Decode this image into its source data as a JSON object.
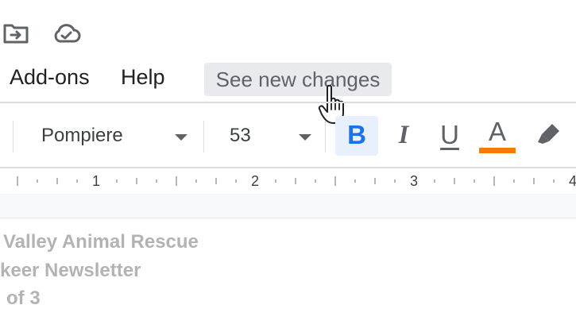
{
  "window": {
    "title_icons": [
      "move-to-folder-icon",
      "cloud-saved-icon"
    ]
  },
  "menu": {
    "items": [
      "Add-ons",
      "Help"
    ],
    "see_new_changes": "See new changes"
  },
  "toolbar": {
    "font_name": "Pompiere",
    "font_size": "53",
    "bold": "B",
    "italic": "I",
    "underline": "U",
    "text_color_glyph": "A",
    "text_color": "#f57c00",
    "bold_active": true
  },
  "ruler": {
    "numbers": [
      "1",
      "2",
      "3",
      "4"
    ]
  },
  "document": {
    "lines": [
      "Valley Animal Rescue",
      "keer Newsletter",
      "of 3"
    ]
  }
}
